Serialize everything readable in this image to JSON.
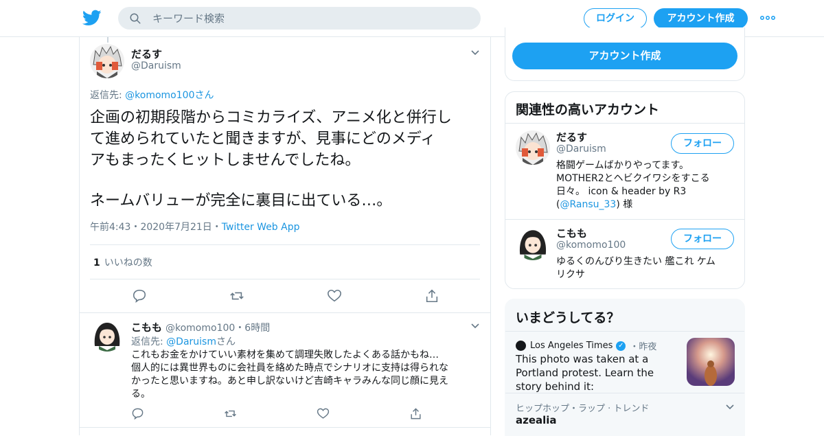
{
  "header": {
    "search_placeholder": "キーワード検索",
    "login_label": "ログイン",
    "signup_label": "アカウント作成"
  },
  "tweet": {
    "name": "だるす",
    "handle": "@Daruism",
    "reply_prefix": "返信先: ",
    "reply_target": "@komomo100",
    "reply_suffix": "さん",
    "text_lines": [
      "企画の初期段階からコミカライズ、アニメ化と併行し",
      "て進められていたと聞きますが、見事にどのメディ",
      "アもまったくヒットしませんでしたね。",
      "ネームバリューが完全に裏目に出ている…。"
    ],
    "time": "午前4:43・2020年7月21日・",
    "app": "Twitter Web App",
    "likes_count": "1",
    "likes_label": "いいねの数"
  },
  "reply": {
    "name": "こもも",
    "handle": "@komomo100",
    "age": "・6時間",
    "reply_prefix": "返信先: ",
    "reply_target": "@Daruism",
    "reply_suffix": "さん",
    "text_lines": [
      "これもお金をかけていい素材を集めて調理失敗したよくある話かもね…",
      "個人的には異世界ものに会社員を絡めた時点でシナリオに支持は得られな",
      "かったと思いますね。あと申し訳ないけど吉崎キャラみんな同じ顔に見え",
      "る。"
    ]
  },
  "sidebar": {
    "cta_label": "アカウント作成",
    "related_title": "関連性の高いアカウント",
    "follow_label": "フォロー",
    "accounts": [
      {
        "name": "だるす",
        "handle": "@Daruism",
        "bio_lines": [
          "格闘ゲームばかりやってます。",
          "MOTHER2とヘビクイワシをすこる",
          "日々。 icon & header by R3"
        ],
        "bio_prefix": "(",
        "bio_link": "@Ransu_33",
        "bio_suffix": ") 様"
      },
      {
        "name": "こもも",
        "handle": "@komomo100",
        "bio_lines": [
          "ゆるくのんびり生きたい 艦これ ケム",
          "リクサ"
        ]
      }
    ],
    "trends_title": "いまどうしてる？",
    "trend_source": "Los Angeles Times",
    "trend_time": "・昨夜",
    "trend_headline": "This photo was taken at a Portland protest. Learn the story behind it:",
    "trend_category": "ヒップホップ・ラップ · トレンド",
    "trend_name": "azealia"
  },
  "colors": {
    "accent": "#1da1f2",
    "link": "#1b95e0",
    "secondary_text": "#657786",
    "border": "#e1e8ed"
  }
}
